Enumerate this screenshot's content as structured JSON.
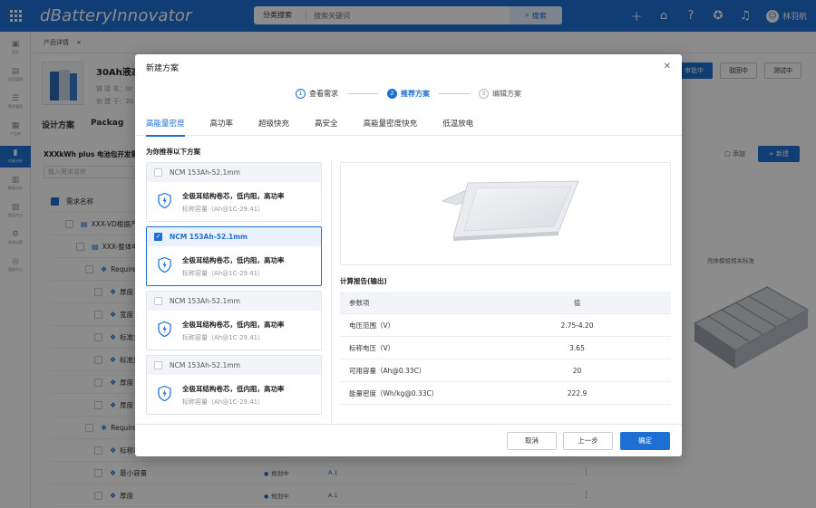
{
  "topbar": {
    "brand": "dBatteryInnovator",
    "search_category": "分类搜索",
    "search_placeholder": "搜索关键词",
    "search_button": "搜索",
    "user_name": "林羽航"
  },
  "sidebar": {
    "items": [
      {
        "label": "首页",
        "icon": "home-icon"
      },
      {
        "label": "项目管理",
        "icon": "folder-icon"
      },
      {
        "label": "需求管理",
        "icon": "list-icon"
      },
      {
        "label": "产品库",
        "icon": "battery-icon",
        "active": true
      },
      {
        "label": "仿真分析",
        "icon": "chart-icon"
      },
      {
        "label": "数据分析",
        "icon": "bar-icon"
      },
      {
        "label": "报告中心",
        "icon": "file-icon"
      },
      {
        "label": "系统设置",
        "icon": "gear-icon"
      },
      {
        "label": "帮助中心",
        "icon": "help-icon"
      }
    ]
  },
  "background": {
    "breadcrumb": "产品详情",
    "product_title": "30Ah液态锂",
    "meta1": "链 接 名：Ur",
    "meta2": "创 建 于：20",
    "buttons": [
      "审批中",
      "驳回中",
      "测试中"
    ],
    "tabs": [
      "设计方案",
      "Packag"
    ],
    "tree_title": "XXXkWh plus 电池包开发需求",
    "tree_search": "输入需求名称",
    "add_label": "添加",
    "new_label": "+ 新建",
    "caption": "壳体模组相关标准",
    "tree_header": "需求名称",
    "rows": [
      {
        "name": "XXX-VD根据产品",
        "status": "",
        "ver": ""
      },
      {
        "name": "XXX-整体电芯",
        "status": "",
        "ver": ""
      },
      {
        "name": "Requirem",
        "status": "",
        "ver": ""
      },
      {
        "name": "厚度",
        "status": "",
        "ver": ""
      },
      {
        "name": "宽度",
        "status": "",
        "ver": ""
      },
      {
        "name": "标准充",
        "status": "",
        "ver": ""
      },
      {
        "name": "标准放",
        "status": "",
        "ver": ""
      },
      {
        "name": "厚度",
        "status": "",
        "ver": ""
      },
      {
        "name": "厚度",
        "status": "",
        "ver": ""
      },
      {
        "name": "Requirem",
        "status": "",
        "ver": ""
      },
      {
        "name": "标称容",
        "status": "",
        "ver": ""
      },
      {
        "name": "最小容量",
        "status": "规划中",
        "ver": "A.1"
      },
      {
        "name": "厚度",
        "status": "规划中",
        "ver": "A.1"
      }
    ]
  },
  "modal": {
    "title": "新建方案",
    "steps": [
      {
        "num": "1",
        "label": "查看需求",
        "state": "done"
      },
      {
        "num": "2",
        "label": "推荐方案",
        "state": "active"
      },
      {
        "num": "3",
        "label": "编辑方案",
        "state": "future"
      }
    ],
    "tabs": [
      "高能量密度",
      "高功率",
      "超级快充",
      "高安全",
      "高能量密度快充",
      "低温放电"
    ],
    "rec_title": "为你推荐以下方案",
    "cards": [
      {
        "name": "NCM 153Ah-52.1mm",
        "desc": "全极耳结构卷芯，低内阻，高功率",
        "sub": "标称容量（Ah@1C-29.41）",
        "selected": false
      },
      {
        "name": "NCM 153Ah-52.1mm",
        "desc": "全极耳结构卷芯，低内阻，高功率",
        "sub": "标称容量（Ah@1C-29.41）",
        "selected": true
      },
      {
        "name": "NCM 153Ah-52.1mm",
        "desc": "全极耳结构卷芯，低内阻，高功率",
        "sub": "标称容量（Ah@1C-29.41）",
        "selected": false
      },
      {
        "name": "NCM 153Ah-52.1mm",
        "desc": "全极耳结构卷芯，低内阻，高功率",
        "sub": "标称容量（Ah@1C-29.41）",
        "selected": false
      }
    ],
    "report_title": "计算报告(输出)",
    "report_header": {
      "key": "参数项",
      "value": "值"
    },
    "report_rows": [
      {
        "key": "电压范围（V）",
        "value": "2.75-4.20"
      },
      {
        "key": "标称电压（V）",
        "value": "3.65"
      },
      {
        "key": "可用容量（Ah@0.33C）",
        "value": "20"
      },
      {
        "key": "能量密度（Wh/kg@0.33C）",
        "value": "222.9"
      }
    ],
    "buttons": {
      "cancel": "取消",
      "prev": "上一步",
      "confirm": "确定"
    }
  },
  "colors": {
    "primary": "#1d6fd3",
    "overlay": "rgba(0,0,0,0.45)"
  }
}
